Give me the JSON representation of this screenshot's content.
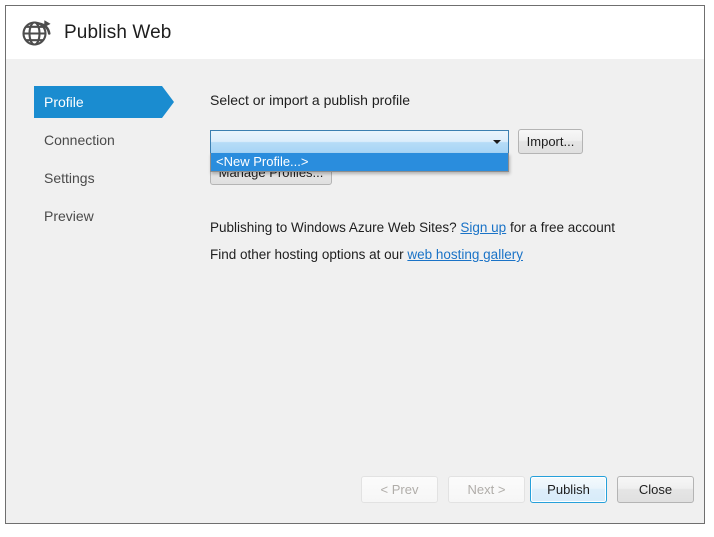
{
  "window": {
    "title": "Publish Web",
    "icon": "globe-publish-icon"
  },
  "sidebar": {
    "items": [
      {
        "label": "Profile",
        "active": true
      },
      {
        "label": "Connection",
        "active": false
      },
      {
        "label": "Settings",
        "active": false
      },
      {
        "label": "Preview",
        "active": false
      }
    ]
  },
  "main": {
    "profile_label": "Select or import a publish profile",
    "combobox": {
      "value": "",
      "placeholder": "",
      "expanded": true,
      "arrow_icon": "chevron-down-icon",
      "options": [
        {
          "label": "<New Profile...>",
          "selected": true
        }
      ]
    },
    "import_label": "Import...",
    "manage_profiles_label": "Manage Profiles...",
    "info_line_1": {
      "prefix": "Publishing to Windows Azure Web Sites? ",
      "link": "Sign up",
      "suffix": " for a free account"
    },
    "info_line_2": {
      "prefix": "Find other hosting options at our ",
      "link": "web hosting gallery",
      "suffix": ""
    }
  },
  "footer": {
    "prev_label": "< Prev",
    "next_label": "Next >",
    "publish_label": "Publish",
    "close_label": "Close"
  },
  "colors": {
    "accent_blue": "#1a8cd0",
    "highlight_blue": "#2a8ddd",
    "link_blue": "#1a73c7",
    "default_button_border": "#26a0da",
    "dialog_background": "#f0f0f0",
    "header_background": "#ffffff"
  }
}
